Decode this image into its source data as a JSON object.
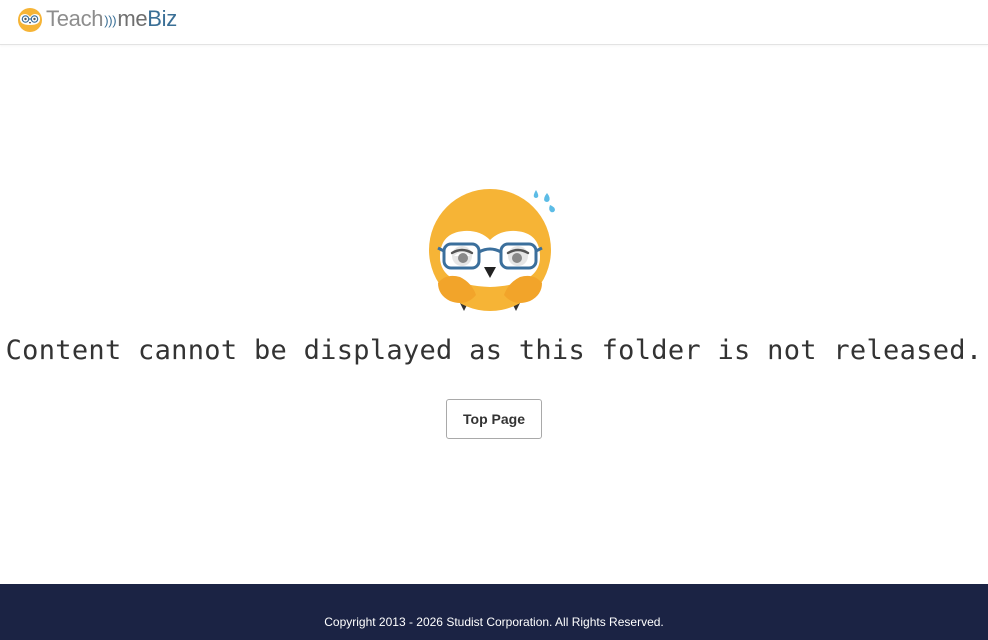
{
  "header": {
    "logo": {
      "icon": "owl-logo-icon",
      "text_teach": "Teach",
      "text_me": "me",
      "text_biz": "Biz",
      "brand_gray": "#8d8d8d",
      "brand_blue": "#3a6f96"
    }
  },
  "main": {
    "illustration": "owl-sweat-illustration",
    "message": "Content cannot be displayed as this folder is not released.",
    "top_page_button": "Top Page"
  },
  "footer": {
    "copyright": "Copyright 2013 - 2026 Studist Corporation. All Rights Reserved.",
    "background": "#1b2344"
  },
  "colors": {
    "owl_orange": "#f6b436",
    "owl_face": "#ffffff",
    "glasses": "#3b6f9c",
    "sweat": "#5cbce6"
  }
}
